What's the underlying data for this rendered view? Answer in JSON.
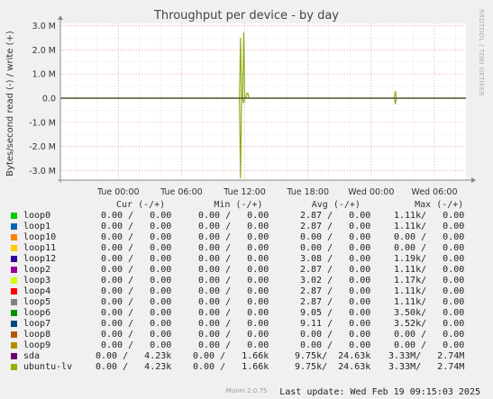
{
  "chart_data": {
    "type": "line",
    "title": "Throughput per device - by day",
    "ylabel": "Bytes/second read (-) / write (+)",
    "xlabel": "",
    "ylim": [
      -3400000,
      3100000
    ],
    "yticks": [
      3000000,
      2000000,
      1000000,
      0,
      -1000000,
      -2000000,
      -3000000
    ],
    "ytick_labels": [
      "3.0 M",
      "2.0 M",
      "1.0 M",
      "0.0",
      "-1.0 M",
      "-2.0 M",
      "-3.0 M"
    ],
    "xlim_hours": [
      -5.5,
      33
    ],
    "xticks_hours": [
      0,
      6,
      12,
      18,
      24,
      30
    ],
    "xtick_labels": [
      "Tue 00:00",
      "Tue 06:00",
      "Tue 12:00",
      "Tue 18:00",
      "Wed 00:00",
      "Wed 06:00"
    ],
    "grid": true,
    "series": [
      {
        "name": "ubuntu-lv",
        "color": "#8fae1b",
        "x_hours": [
          -5.5,
          11.5,
          11.6,
          11.7,
          11.8,
          11.9,
          12.0,
          12.1,
          12.2,
          12.3,
          12.4,
          12.5,
          12.6,
          12.7,
          12.8,
          12.9,
          13.0,
          13.1,
          13.3,
          26.2,
          26.3,
          26.4,
          26.5,
          26.6,
          33
        ],
        "values_write": [
          0,
          0,
          2500000,
          0,
          0,
          2740000,
          0,
          0,
          200000,
          200000,
          0,
          0,
          0,
          0,
          0,
          0,
          0,
          0,
          0,
          0,
          300000,
          0,
          0,
          0,
          0
        ],
        "values_read": [
          0,
          0,
          -3330000,
          0,
          0,
          -200000,
          0,
          0,
          0,
          0,
          0,
          0,
          0,
          0,
          0,
          0,
          0,
          0,
          0,
          0,
          -250000,
          0,
          0,
          0,
          0
        ]
      }
    ]
  },
  "legend": {
    "header": "Cur (-/+)         Min (-/+)         Avg (-/+)          Max (-/+)",
    "rows": [
      {
        "name": "loop0",
        "color": "#00cc00",
        "cur": "0.00 /   0.00",
        "min": "0.00 /   0.00",
        "avg": "2.87 /   0.00",
        "max": "1.11k/   0.00"
      },
      {
        "name": "loop1",
        "color": "#0066b3",
        "cur": "0.00 /   0.00",
        "min": "0.00 /   0.00",
        "avg": "2.87 /   0.00",
        "max": "1.11k/   0.00"
      },
      {
        "name": "loop10",
        "color": "#ff8000",
        "cur": "0.00 /   0.00",
        "min": "0.00 /   0.00",
        "avg": "0.00 /   0.00",
        "max": "0.00 /   0.00"
      },
      {
        "name": "loop11",
        "color": "#ffcc00",
        "cur": "0.00 /   0.00",
        "min": "0.00 /   0.00",
        "avg": "0.00 /   0.00",
        "max": "0.00 /   0.00"
      },
      {
        "name": "loop12",
        "color": "#330099",
        "cur": "0.00 /   0.00",
        "min": "0.00 /   0.00",
        "avg": "3.08 /   0.00",
        "max": "1.19k/   0.00"
      },
      {
        "name": "loop2",
        "color": "#990099",
        "cur": "0.00 /   0.00",
        "min": "0.00 /   0.00",
        "avg": "2.87 /   0.00",
        "max": "1.11k/   0.00"
      },
      {
        "name": "loop3",
        "color": "#ccff00",
        "cur": "0.00 /   0.00",
        "min": "0.00 /   0.00",
        "avg": "3.02 /   0.00",
        "max": "1.17k/   0.00"
      },
      {
        "name": "loop4",
        "color": "#ff0000",
        "cur": "0.00 /   0.00",
        "min": "0.00 /   0.00",
        "avg": "2.87 /   0.00",
        "max": "1.11k/   0.00"
      },
      {
        "name": "loop5",
        "color": "#808080",
        "cur": "0.00 /   0.00",
        "min": "0.00 /   0.00",
        "avg": "2.87 /   0.00",
        "max": "1.11k/   0.00"
      },
      {
        "name": "loop6",
        "color": "#008f00",
        "cur": "0.00 /   0.00",
        "min": "0.00 /   0.00",
        "avg": "9.05 /   0.00",
        "max": "3.50k/   0.00"
      },
      {
        "name": "loop7",
        "color": "#00487d",
        "cur": "0.00 /   0.00",
        "min": "0.00 /   0.00",
        "avg": "9.11 /   0.00",
        "max": "3.52k/   0.00"
      },
      {
        "name": "loop8",
        "color": "#b35a00",
        "cur": "0.00 /   0.00",
        "min": "0.00 /   0.00",
        "avg": "0.00 /   0.00",
        "max": "0.00 /   0.00"
      },
      {
        "name": "loop9",
        "color": "#b38f00",
        "cur": "0.00 /   0.00",
        "min": "0.00 /   0.00",
        "avg": "0.00 /   0.00",
        "max": "0.00 /   0.00"
      },
      {
        "name": "sda",
        "color": "#6b006b",
        "cur": "0.00 /   4.23k",
        "min": "0.00 /   1.66k",
        "avg": "9.75k/  24.63k",
        "max": "3.33M/   2.74M"
      },
      {
        "name": "ubuntu-lv",
        "color": "#8fb300",
        "cur": "0.00 /   4.23k",
        "min": "0.00 /   1.66k",
        "avg": "9.75k/  24.63k",
        "max": "3.33M/   2.74M"
      }
    ]
  },
  "last_update": "Last update: Wed Feb 19 09:15:03 2025",
  "footer": "Munin 2.0.75",
  "watermark": "RRDTOOL / TOBI OETIKER"
}
